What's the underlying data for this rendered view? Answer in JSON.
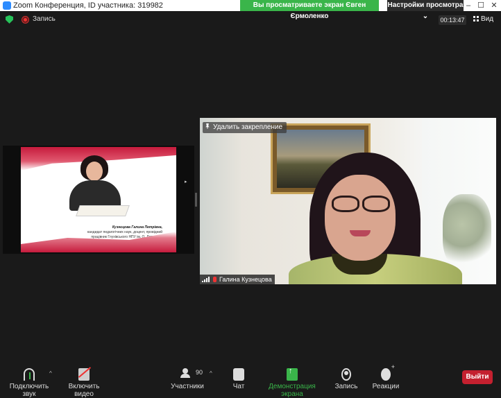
{
  "window": {
    "title": "Zoom Конференция, ID участника: 319982",
    "share_banner": "Вы просматриваете экран Євген Єрмоленко",
    "view_settings": "Настройки просмотра ⌄",
    "controls": [
      "–",
      "☐",
      "✕"
    ]
  },
  "topbar": {
    "recording_label": "Запись",
    "timer": "00:13:47",
    "view_label": "Вид"
  },
  "shared_slide": {
    "caption_name": "Кузнєцова Галина Петрівна,",
    "caption_line2": "кандидат педагогічних наук, доцент, провідний",
    "caption_line3": "працівник Глухівського НПУ ім. О. Довженка",
    "arrow": "▸"
  },
  "video": {
    "unpin_label": "Удалить закрепление",
    "participant_name": "Галина Кузнецова"
  },
  "toolbar": {
    "audio_label": "Подключить звук",
    "video_label": "Включить видео",
    "participants_label": "Участники",
    "participants_count": "90",
    "chat_label": "Чат",
    "share_label": "Демонстрация экрана",
    "record_label": "Запись",
    "reactions_label": "Реакции",
    "end_label": "Выйти",
    "caret": "^"
  },
  "colors": {
    "share_green": "#3ab54a",
    "end_red": "#c4202f",
    "background": "#1a1a1a"
  }
}
